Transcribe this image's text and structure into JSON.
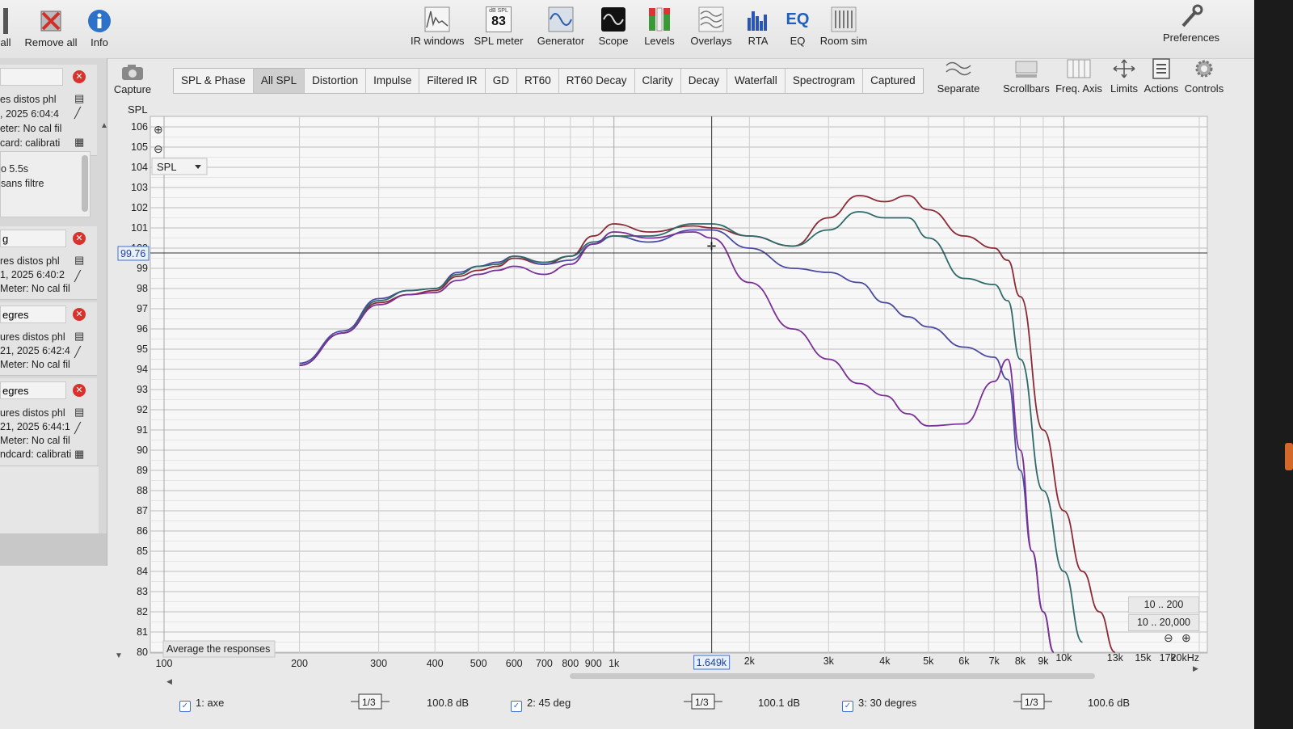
{
  "toolbar": {
    "left_items": [
      {
        "label": "all",
        "icon": "partial-icon"
      },
      {
        "label": "Remove all",
        "icon": "remove-all-icon"
      },
      {
        "label": "Info",
        "icon": "info-icon"
      }
    ],
    "spl_badge": {
      "unit": "dB SPL",
      "value": "83"
    },
    "center_items": [
      {
        "label": "IR windows",
        "icon": "ir-windows-icon"
      },
      {
        "label": "SPL meter",
        "icon": "spl-meter-icon"
      },
      {
        "label": "Generator",
        "icon": "generator-icon"
      },
      {
        "label": "Scope",
        "icon": "scope-icon"
      },
      {
        "label": "Levels",
        "icon": "levels-icon"
      },
      {
        "label": "Overlays",
        "icon": "overlays-icon"
      },
      {
        "label": "RTA",
        "icon": "rta-icon"
      },
      {
        "label": "EQ",
        "icon": "eq-icon"
      },
      {
        "label": "Room sim",
        "icon": "room-sim-icon"
      }
    ],
    "preferences": "Preferences"
  },
  "capture_label": "Capture",
  "tabs": [
    "SPL & Phase",
    "All SPL",
    "Distortion",
    "Impulse",
    "Filtered IR",
    "GD",
    "RT60",
    "RT60 Decay",
    "Clarity",
    "Decay",
    "Waterfall",
    "Spectrogram",
    "Captured"
  ],
  "active_tab": "All SPL",
  "right_tools": [
    "Separate",
    "Scrollbars",
    "Freq. Axis",
    "Limits",
    "Actions",
    "Controls"
  ],
  "measurements": [
    {
      "name": "",
      "lines": [
        "es distos phl",
        ", 2025 6:04:4",
        "eter: No cal fil",
        "card: calibrati"
      ]
    },
    {
      "name": "g",
      "lines": [
        "res distos phl",
        "1, 2025 6:40:2",
        "Meter: No cal fil"
      ]
    },
    {
      "name": "egres",
      "lines": [
        "ures distos phl",
        "21, 2025 6:42:4",
        "Meter: No cal fil"
      ]
    },
    {
      "name": "egres",
      "lines": [
        "ures distos phl",
        "21, 2025 6:44:1",
        "Meter: No cal fil",
        "ndcard: calibrati"
      ]
    }
  ],
  "notes": [
    "o 5.5s",
    "sans filtre"
  ],
  "graph": {
    "y_axis_title": "SPL",
    "dropdown": "SPL",
    "cursor_value": "99.76",
    "cursor_freq": "1.649k",
    "average_button": "Average the responses",
    "y_ticks": [
      "106",
      "105",
      "104",
      "103",
      "102",
      "101",
      "100",
      "99",
      "98",
      "97",
      "96",
      "95",
      "94",
      "93",
      "92",
      "91",
      "90",
      "89",
      "88",
      "87",
      "86",
      "85",
      "84",
      "83",
      "82",
      "81",
      "80"
    ],
    "x_ticks": [
      "100",
      "200",
      "300",
      "400",
      "500",
      "600",
      "700",
      "800",
      "900",
      "1k",
      "2k",
      "3k",
      "4k",
      "5k",
      "6k",
      "7k",
      "8k",
      "9k",
      "10k",
      "13k",
      "15k",
      "17k",
      "20kHz"
    ],
    "range_y": "10 .. 200",
    "range_x": "10 .. 20,000"
  },
  "chart_data": {
    "type": "line",
    "title": "",
    "xlabel": "",
    "ylabel": "SPL",
    "xscale": "log",
    "xlim": [
      100,
      20000
    ],
    "ylim": [
      80,
      106
    ],
    "series": [
      {
        "name": "1: axe",
        "color": "#8b2a35",
        "x": [
          200,
          250,
          300,
          350,
          400,
          450,
          500,
          550,
          600,
          700,
          800,
          900,
          1000,
          1200,
          1500,
          1649,
          2000,
          2500,
          3000,
          3500,
          4000,
          4500,
          5000,
          6000,
          7000,
          7500,
          8000,
          9000,
          10000,
          11000,
          12000,
          13000
        ],
        "y": [
          94.2,
          95.8,
          97.3,
          97.7,
          97.9,
          98.6,
          98.9,
          99.1,
          99.5,
          99.2,
          99.6,
          100.6,
          101.2,
          100.8,
          101.1,
          101.0,
          100.6,
          100.1,
          101.5,
          102.6,
          102.3,
          102.6,
          101.9,
          100.6,
          100.0,
          99.4,
          97.6,
          91.0,
          87.0,
          84.0,
          82.0,
          80.0
        ]
      },
      {
        "name": "2: 45 deg",
        "color": "#4a4aa0",
        "x": [
          200,
          250,
          300,
          350,
          400,
          450,
          500,
          550,
          600,
          700,
          800,
          900,
          1000,
          1200,
          1500,
          1649,
          2000,
          2500,
          3000,
          3500,
          4000,
          4500,
          5000,
          6000,
          7000,
          7500,
          8000,
          8500,
          9000,
          9500
        ],
        "y": [
          94.3,
          95.9,
          97.5,
          97.9,
          98.0,
          98.8,
          99.1,
          99.3,
          99.6,
          99.2,
          99.4,
          100.2,
          100.6,
          100.3,
          100.9,
          100.9,
          100.0,
          99.0,
          98.8,
          98.3,
          97.3,
          96.6,
          96.1,
          95.1,
          94.6,
          93.5,
          89.0,
          85.0,
          82.0,
          80.0
        ]
      },
      {
        "name": "3: 30 degres",
        "color": "#2f6a6a",
        "x": [
          200,
          250,
          300,
          350,
          400,
          450,
          500,
          550,
          600,
          700,
          800,
          900,
          1000,
          1200,
          1500,
          1649,
          2000,
          2500,
          3000,
          3500,
          4000,
          4500,
          5000,
          6000,
          7000,
          7500,
          8000,
          9000,
          10000,
          11000
        ],
        "y": [
          94.2,
          95.8,
          97.4,
          97.9,
          98.0,
          98.7,
          99.1,
          99.2,
          99.6,
          99.3,
          99.6,
          100.3,
          100.6,
          100.6,
          101.2,
          101.2,
          100.6,
          100.1,
          100.9,
          101.8,
          101.5,
          101.5,
          100.5,
          98.5,
          98.2,
          97.4,
          94.5,
          88.0,
          84.0,
          80.5
        ]
      },
      {
        "name": "",
        "color": "#7a2f98",
        "x": [
          200,
          250,
          300,
          350,
          400,
          450,
          500,
          550,
          600,
          700,
          800,
          900,
          1000,
          1200,
          1500,
          1649,
          2000,
          2500,
          3000,
          3500,
          4000,
          4500,
          5000,
          6000,
          7000,
          7500,
          8000,
          8500,
          9000,
          9500
        ],
        "y": [
          94.2,
          95.8,
          97.2,
          97.7,
          97.8,
          98.4,
          98.7,
          98.9,
          99.1,
          98.7,
          99.2,
          100.2,
          100.8,
          100.5,
          100.8,
          100.5,
          98.3,
          96.0,
          94.5,
          93.3,
          92.7,
          91.8,
          91.2,
          91.3,
          93.4,
          94.5,
          90.0,
          85.0,
          82.0,
          80.0
        ]
      }
    ]
  },
  "bottom": {
    "m1": {
      "label": "1: axe",
      "smoothing": "1/3",
      "level": "100.8 dB"
    },
    "m2": {
      "label": "2: 45 deg",
      "smoothing": "1/3",
      "level": "100.1 dB"
    },
    "m3": {
      "label": "3: 30 degres",
      "smoothing": "1/3",
      "level": "100.6 dB"
    }
  }
}
